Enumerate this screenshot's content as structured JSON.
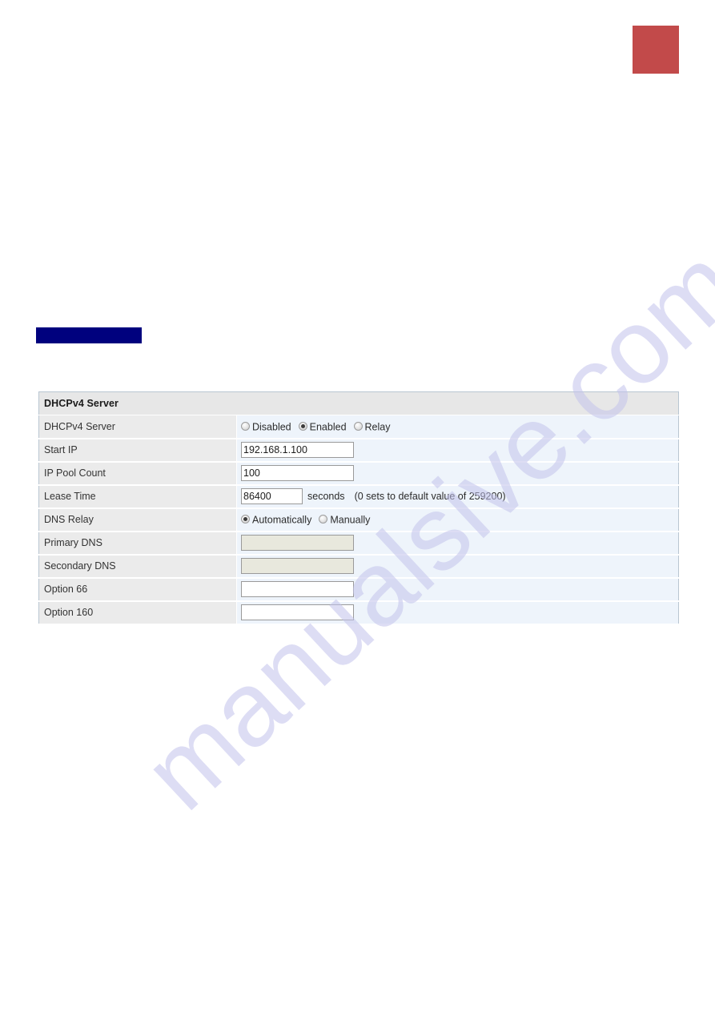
{
  "page": {
    "background_color": "#ffffff",
    "watermark": "manualsive.com",
    "watermark_color": "#c3c3ec"
  },
  "corner_block": {
    "name": "red-corner-block",
    "color": "#c24a4a"
  },
  "heading_bar": {
    "name": "redacted-heading-bar",
    "color": "#00017e",
    "text": ""
  },
  "table": {
    "section_title": "DHCPv4 Server",
    "header_bg": "#e7e7e7",
    "label_bg": "#ebebeb",
    "value_bg": "#eef4fb",
    "rows": [
      {
        "label": "DHCPv4 Server",
        "type": "radio",
        "options": [
          {
            "label": "Disabled",
            "checked": false
          },
          {
            "label": "Enabled",
            "checked": true
          },
          {
            "label": "Relay",
            "checked": false
          }
        ]
      },
      {
        "label": "Start IP",
        "type": "text",
        "value": "192.168.1.100",
        "placeholder": "",
        "disabled": false,
        "width": "wide"
      },
      {
        "label": "IP Pool Count",
        "type": "text",
        "value": "100",
        "placeholder": "",
        "disabled": false,
        "width": "wide"
      },
      {
        "label": "Lease Time",
        "type": "text-with-hint",
        "value": "86400",
        "placeholder": "",
        "disabled": false,
        "width": "narrow",
        "unit": "seconds",
        "note": "(0 sets to default value of 259200)"
      },
      {
        "label": "DNS Relay",
        "type": "radio",
        "options": [
          {
            "label": "Automatically",
            "checked": true
          },
          {
            "label": "Manually",
            "checked": false
          }
        ]
      },
      {
        "label": "Primary DNS",
        "type": "text",
        "value": "",
        "placeholder": "",
        "disabled": true,
        "width": "wide"
      },
      {
        "label": "Secondary DNS",
        "type": "text",
        "value": "",
        "placeholder": "",
        "disabled": true,
        "width": "wide"
      },
      {
        "label": "Option 66",
        "type": "text",
        "value": "",
        "placeholder": "",
        "disabled": false,
        "width": "wide"
      },
      {
        "label": "Option 160",
        "type": "text",
        "value": "",
        "placeholder": "",
        "disabled": false,
        "width": "wide"
      }
    ]
  }
}
